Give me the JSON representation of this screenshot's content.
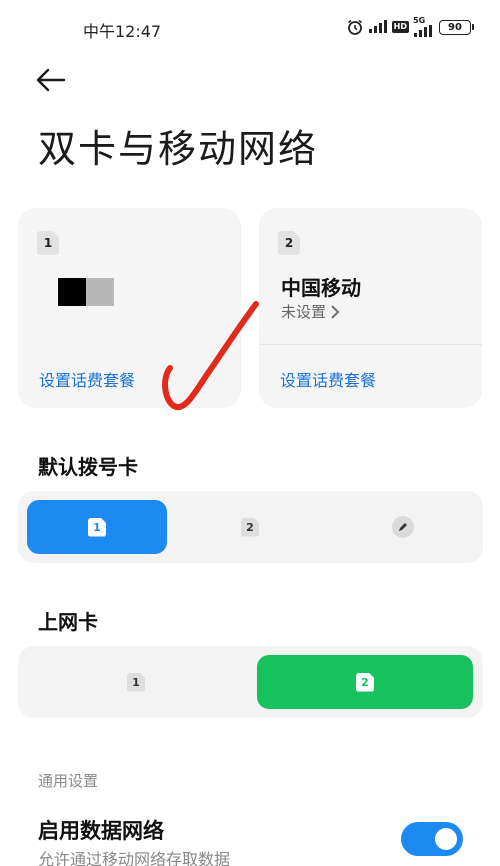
{
  "status_bar": {
    "time": "中午12:47",
    "hd_label": "HD",
    "network_label": "5G",
    "battery": "90"
  },
  "header": {
    "title": "双卡与移动网络"
  },
  "sim_cards": [
    {
      "slot": "1",
      "carrier": "",
      "status": "",
      "plan_link": "设置话费套餐"
    },
    {
      "slot": "2",
      "carrier": "中国移动",
      "status": "未设置",
      "plan_link": "设置话费套餐"
    }
  ],
  "default_dial": {
    "title": "默认拨号卡",
    "options": [
      "1",
      "2",
      "edit"
    ],
    "selected": "1"
  },
  "data_sim": {
    "title": "上网卡",
    "options": [
      "1",
      "2"
    ],
    "selected": "2"
  },
  "general": {
    "label": "通用设置",
    "mobile_data": {
      "title": "启用数据网络",
      "subtitle": "允许通过移动网络存取数据",
      "enabled": true
    }
  },
  "colors": {
    "accent_blue": "#1d8af2",
    "accent_green": "#16c15e",
    "link_blue": "#1a73d9",
    "annotation_red": "#e02a1c"
  },
  "icons": {
    "back": "arrow-left-icon",
    "alarm": "alarm-icon",
    "signal": "signal-icon",
    "battery": "battery-icon",
    "edit": "pencil-icon",
    "chevron": "chevron-right-icon"
  }
}
